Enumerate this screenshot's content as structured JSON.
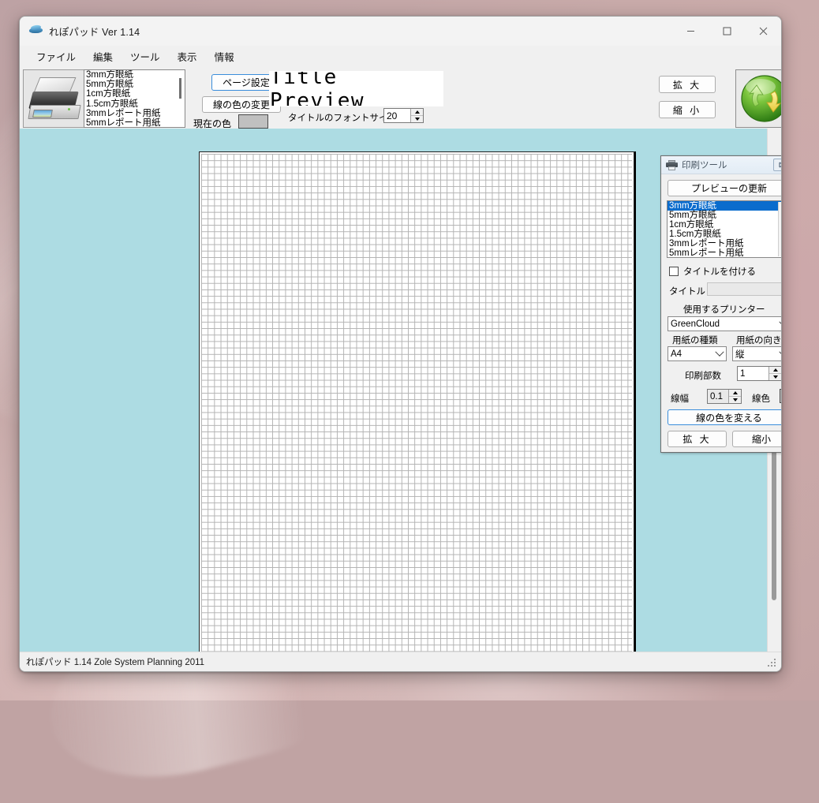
{
  "window": {
    "title": "れぽパッド  Ver 1.14",
    "app_icon": "boat-icon",
    "controls": {
      "minimize": "minimize-icon",
      "maximize": "maximize-icon",
      "close": "close-icon"
    }
  },
  "menubar": {
    "items": [
      {
        "label": "ファイル"
      },
      {
        "label": "編集"
      },
      {
        "label": "ツール"
      },
      {
        "label": "表示"
      },
      {
        "label": "情報"
      }
    ]
  },
  "toolbar": {
    "printer_thumbnail": "printer-icon",
    "paper_list": [
      "3mm方眼紙",
      "5mm方眼紙",
      "1cm方眼紙",
      "1.5cm方眼紙",
      "3mmレポート用紙",
      "5mmレポート用紙"
    ],
    "page_setup_label": "ページ設定",
    "line_color_label": "線の色の変更",
    "current_color_label": "現在の色",
    "current_color_value": "#c0c0c0",
    "title_preview_text": "Title Preview",
    "font_size_label": "タイトルのフォントサイズ",
    "font_size_value": "20",
    "zoom_in_label": "拡 大",
    "zoom_out_label": "縮 小",
    "refresh_icon": "refresh-circular-arrows-icon"
  },
  "workspace": {
    "background_color": "#addce3",
    "paper": {
      "grid_type": "3mm方眼紙",
      "grid_color": "#b3b3b3",
      "paper_color": "#ffffff"
    }
  },
  "print_panel": {
    "title": "印刷ツール",
    "title_icon": "printer-icon",
    "close_icon": "close-icon",
    "refresh_preview_label": "プレビューの更新",
    "paper_list": [
      "3mm方眼紙",
      "5mm方眼紙",
      "1cm方眼紙",
      "1.5cm方眼紙",
      "3mmレポート用紙",
      "5mmレポート用紙"
    ],
    "paper_list_selected_index": 0,
    "selection_color": "#0a6ccd",
    "add_title_checkbox_label": "タイトルを付ける",
    "add_title_checked": false,
    "title_field_label": "タイトル",
    "title_field_value": "",
    "printer_label": "使用するプリンター",
    "printer_value": "GreenCloud",
    "paper_type_label": "用紙の種類",
    "paper_type_value": "A4",
    "orientation_label": "用紙の向き",
    "orientation_value": "縦",
    "copies_label": "印刷部数",
    "copies_value": "1",
    "line_width_label": "線幅",
    "line_width_value": "0.1",
    "line_color_label": "線色",
    "line_color_value": "#c0c0c0",
    "change_line_color_label": "線の色を変える",
    "zoom_in_label": "拡 大",
    "zoom_out_label": "縮小"
  },
  "statusbar": {
    "text": "れぽパッド  1.14    Zole System Planning  2011"
  }
}
